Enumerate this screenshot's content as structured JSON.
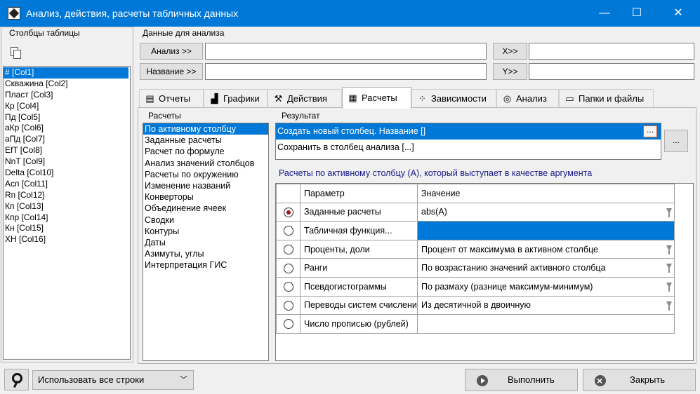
{
  "window": {
    "title": "Анализ, действия, расчеты табличных данных",
    "minimize_glyph": "—",
    "maximize_glyph": "☐",
    "close_glyph": "✕"
  },
  "left_panel": {
    "caption": "Столбцы таблицы",
    "columns": [
      "# [Col1]",
      "Скважина [Col2]",
      "Пласт [Col3]",
      "Кр [Col4]",
      "Пд [Col5]",
      "аКр [Col6]",
      "аПд [Col7]",
      "EfT [Col8]",
      "NnT [Col9]",
      "Delta [Col10]",
      "Асп [Col11]",
      "Rп [Col12]",
      "Кп [Col13]",
      "Кпр [Col14]",
      "Кн [Col15]",
      "ХН [Col16]"
    ],
    "selected_index": 0
  },
  "analysis_data": {
    "caption": "Данные для анализа",
    "analysis_btn": "Анализ >>",
    "analysis_value": "",
    "x_btn": "X>>",
    "x_value": "",
    "name_btn": "Название >>",
    "name_value": "",
    "y_btn": "Y>>",
    "y_value": ""
  },
  "tabs": [
    {
      "label": "Отчеты",
      "icon": "report-icon",
      "glyph": "▤"
    },
    {
      "label": "Графики",
      "icon": "chart-icon",
      "glyph": "▟"
    },
    {
      "label": "Действия",
      "icon": "hammer-icon",
      "glyph": "⚒"
    },
    {
      "label": "Расчеты",
      "icon": "table-icon",
      "glyph": "▦",
      "active": true
    },
    {
      "label": "Зависимости",
      "icon": "scatter-icon",
      "glyph": "⁘"
    },
    {
      "label": "Анализ",
      "icon": "target-icon",
      "glyph": "◎"
    },
    {
      "label": "Папки и файлы",
      "icon": "folder-icon",
      "glyph": "▭"
    }
  ],
  "calculations": {
    "caption": "Расчеты",
    "items": [
      "По активному столбцу",
      "Заданные расчеты",
      "Расчет по формуле",
      "Анализ значений столбцов",
      "Расчеты по окружению",
      "Изменение названий",
      "Конверторы",
      "Объединение ячеек",
      "Сводки",
      "Контуры",
      "Даты",
      "Азимуты, углы",
      "Интерпретация ГИС"
    ],
    "selected_index": 0
  },
  "result": {
    "caption": "Результат",
    "items": [
      "Создать новый столбец. Название []",
      "Сохранить в столбец анализа [...]"
    ],
    "selected_index": 0,
    "inline_btn": "...",
    "side_btn": "..."
  },
  "note": "Расчеты по активному столбцу (А), который выступает в качестве аргумента",
  "grid": {
    "headers": {
      "param": "Параметр",
      "value": "Значение"
    },
    "rows": [
      {
        "param": "Заданные расчеты",
        "value": "abs(A)",
        "checked": true,
        "filter": true,
        "highlight": false
      },
      {
        "param": "Табличная функция...",
        "value": "",
        "checked": false,
        "filter": false,
        "highlight": true
      },
      {
        "param": "Проценты, доли",
        "value": "Процент от максимума в активном столбце",
        "checked": false,
        "filter": true,
        "highlight": false
      },
      {
        "param": "Ранги",
        "value": "По возрастанию значений активного столбца",
        "checked": false,
        "filter": true,
        "highlight": false
      },
      {
        "param": "Псевдогистограммы",
        "value": "По размаху (разнице максимум-минимум)",
        "checked": false,
        "filter": true,
        "highlight": false
      },
      {
        "param": "Переводы систем счисления",
        "value": "Из десятичной в двоичную",
        "checked": false,
        "filter": true,
        "highlight": false
      },
      {
        "param": "Число прописью (рублей)",
        "value": "",
        "checked": false,
        "filter": false,
        "highlight": false
      }
    ]
  },
  "bottom": {
    "rows_select": "Использовать все строки",
    "run_btn": "Выполнить",
    "close_btn": "Закрыть"
  }
}
